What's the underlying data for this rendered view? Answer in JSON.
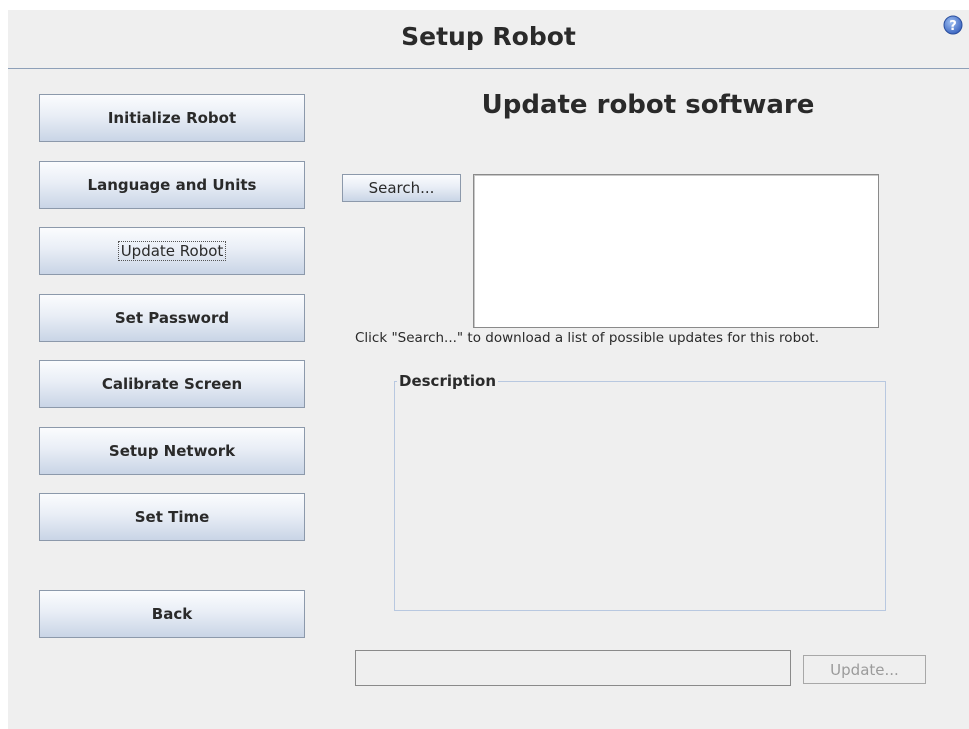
{
  "header": {
    "title": "Setup Robot",
    "help_icon": "question-circle-icon"
  },
  "sidebar": {
    "items": [
      {
        "label": "Initialize Robot"
      },
      {
        "label": "Language and Units"
      },
      {
        "label": "Update Robot",
        "selected": true
      },
      {
        "label": "Set Password"
      },
      {
        "label": "Calibrate Screen"
      },
      {
        "label": "Setup Network"
      },
      {
        "label": "Set Time"
      }
    ],
    "back_label": "Back"
  },
  "main": {
    "title": "Update robot software",
    "search_label": "Search...",
    "hint": "Click \"Search...\" to download a list of possible updates for this robot.",
    "description_label": "Description",
    "path_value": "",
    "update_label": "Update..."
  },
  "colors": {
    "background": "#efefef",
    "button_gradient_top": "#fbfcfe",
    "button_gradient_bottom": "#c9d5e6",
    "help_icon": "#4a74c8"
  }
}
